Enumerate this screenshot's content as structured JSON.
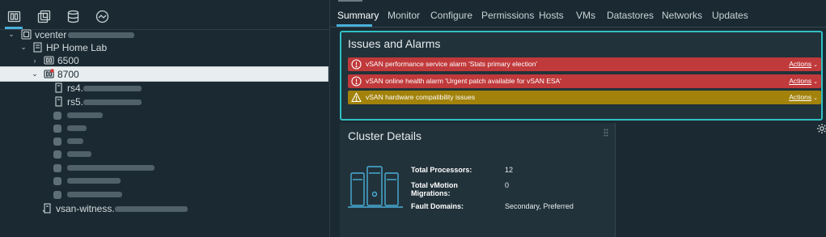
{
  "navigator": {
    "tabs": [
      {
        "icon": "hosts-and-clusters-icon"
      },
      {
        "icon": "vms-and-templates-icon"
      },
      {
        "icon": "storage-icon"
      },
      {
        "icon": "networking-icon"
      }
    ],
    "tree": {
      "vcenter_label": "vcenter",
      "datacenter_label": "HP Home Lab",
      "cluster_6500_label": "6500",
      "cluster_8700_label": "8700",
      "host_rs4_label": "rs4.",
      "host_rs5_label": "rs5.",
      "witness_label": "vsan-witness."
    }
  },
  "main": {
    "tabs": [
      "Summary",
      "Monitor",
      "Configure",
      "Permissions",
      "Hosts",
      "VMs",
      "Datastores",
      "Networks",
      "Updates"
    ],
    "active_tab": "Summary",
    "issues": {
      "title": "Issues and Alarms",
      "items": [
        {
          "text": "vSAN performance service alarm 'Stats primary election'",
          "severity": "critical",
          "action": "Actions"
        },
        {
          "text": "vSAN online health alarm 'Urgent patch available for vSAN ESA'",
          "severity": "critical",
          "action": "Actions"
        },
        {
          "text": "vSAN hardware compatibility issues",
          "severity": "warning",
          "action": "Actions"
        }
      ]
    },
    "cluster_details": {
      "title": "Cluster Details",
      "total_processors_label": "Total Processors:",
      "total_processors_value": "12",
      "total_vmotion_label_1": "Total vMotion",
      "total_vmotion_label_2": "Migrations:",
      "total_vmotion_value": "0",
      "fault_domains_label": "Fault Domains:",
      "fault_domains_value": "Secondary, Preferred"
    }
  },
  "colors": {
    "background": "#1b2a32",
    "accent": "#49afd9",
    "critical": "#c0393b",
    "warning": "#a2820b",
    "focus_border": "#2fc0c4"
  }
}
